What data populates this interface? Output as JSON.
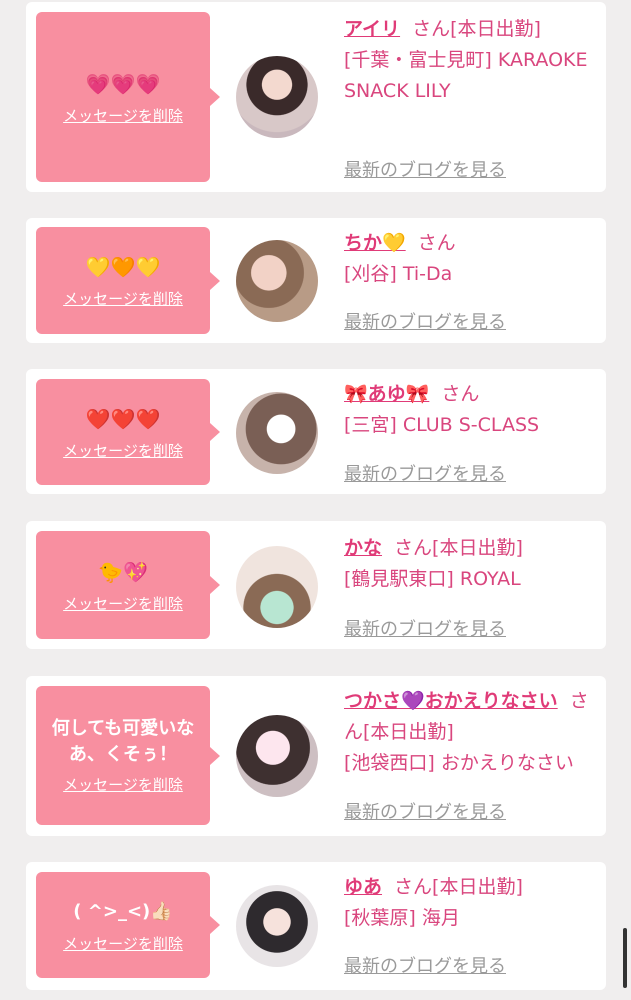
{
  "cards": [
    {
      "message": "💗💗💗",
      "delete_label": "メッセージを削除",
      "name": "アイリ",
      "san": "さん",
      "shift": "[本日出勤]",
      "shop": "[千葉・富士見町] KARAOKE SNACK LILY",
      "blog_label": "最新のブログを見る"
    },
    {
      "message": "💛🧡💛",
      "delete_label": "メッセージを削除",
      "name": "ちか💛",
      "san": "さん",
      "shift": "",
      "shop": "[刈谷] Ti-Da",
      "blog_label": "最新のブログを見る"
    },
    {
      "message": "❤️❤️❤️",
      "delete_label": "メッセージを削除",
      "name": "🎀あゆ🎀",
      "san": "さん",
      "shift": "",
      "shop": "[三宮] CLUB S-CLASS",
      "blog_label": "最新のブログを見る"
    },
    {
      "message": "🐤💖",
      "delete_label": "メッセージを削除",
      "name": "かな",
      "san": "さん",
      "shift": "[本日出勤]",
      "shop": "[鶴見駅東口] ROYAL",
      "blog_label": "最新のブログを見る"
    },
    {
      "message": "何しても可愛いなあ、くそぅ！",
      "delete_label": "メッセージを削除",
      "name": "つかさ💜おかえりなさい",
      "san": "さん",
      "shift": "[本日出勤]",
      "shop": "[池袋西口] おかえりなさい",
      "blog_label": "最新のブログを見る"
    },
    {
      "message": "( ^>_<)👍🏻",
      "delete_label": "メッセージを削除",
      "name": "ゆあ",
      "san": "さん",
      "shift": "[本日出勤]",
      "shop": "[秋葉原] 海月",
      "blog_label": "最新のブログを見る"
    }
  ],
  "colors": {
    "background": "#f0eeee",
    "card": "#ffffff",
    "bubble": "#f88fa0",
    "name": "#e03b78",
    "shop": "#d9467e",
    "blog_link": "#9a9a9a"
  }
}
